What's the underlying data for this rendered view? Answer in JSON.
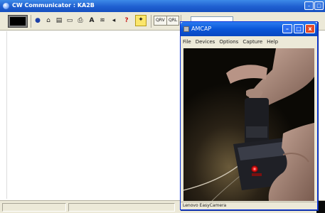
{
  "main_window": {
    "title": "CW Communicator : KA2B",
    "controls": [
      "–",
      "□"
    ]
  },
  "toolbar": {
    "color_swatch": "#000000",
    "tools": [
      {
        "name": "connect-icon",
        "glyph": "●"
      },
      {
        "name": "home-icon",
        "glyph": "⌂"
      },
      {
        "name": "notepad-icon",
        "glyph": "▤"
      },
      {
        "name": "open-folder-icon",
        "glyph": "▭"
      },
      {
        "name": "print-icon",
        "glyph": "⎙"
      },
      {
        "name": "font-icon",
        "glyph": "A"
      },
      {
        "name": "frequency-icon",
        "glyph": "≋"
      },
      {
        "name": "speaker-icon",
        "glyph": "◂"
      },
      {
        "name": "help-icon",
        "glyph": "?"
      },
      {
        "name": "wizard-icon",
        "glyph": "✦"
      }
    ],
    "qrv_label": "QRV",
    "qrl_label": "QRL"
  },
  "amcap": {
    "title": "AMCAP",
    "controls": [
      "–",
      "□",
      "x"
    ],
    "menu": [
      "File",
      "Devices",
      "Options",
      "Capture",
      "Help"
    ],
    "status": "Lenovo EasyCamera"
  }
}
